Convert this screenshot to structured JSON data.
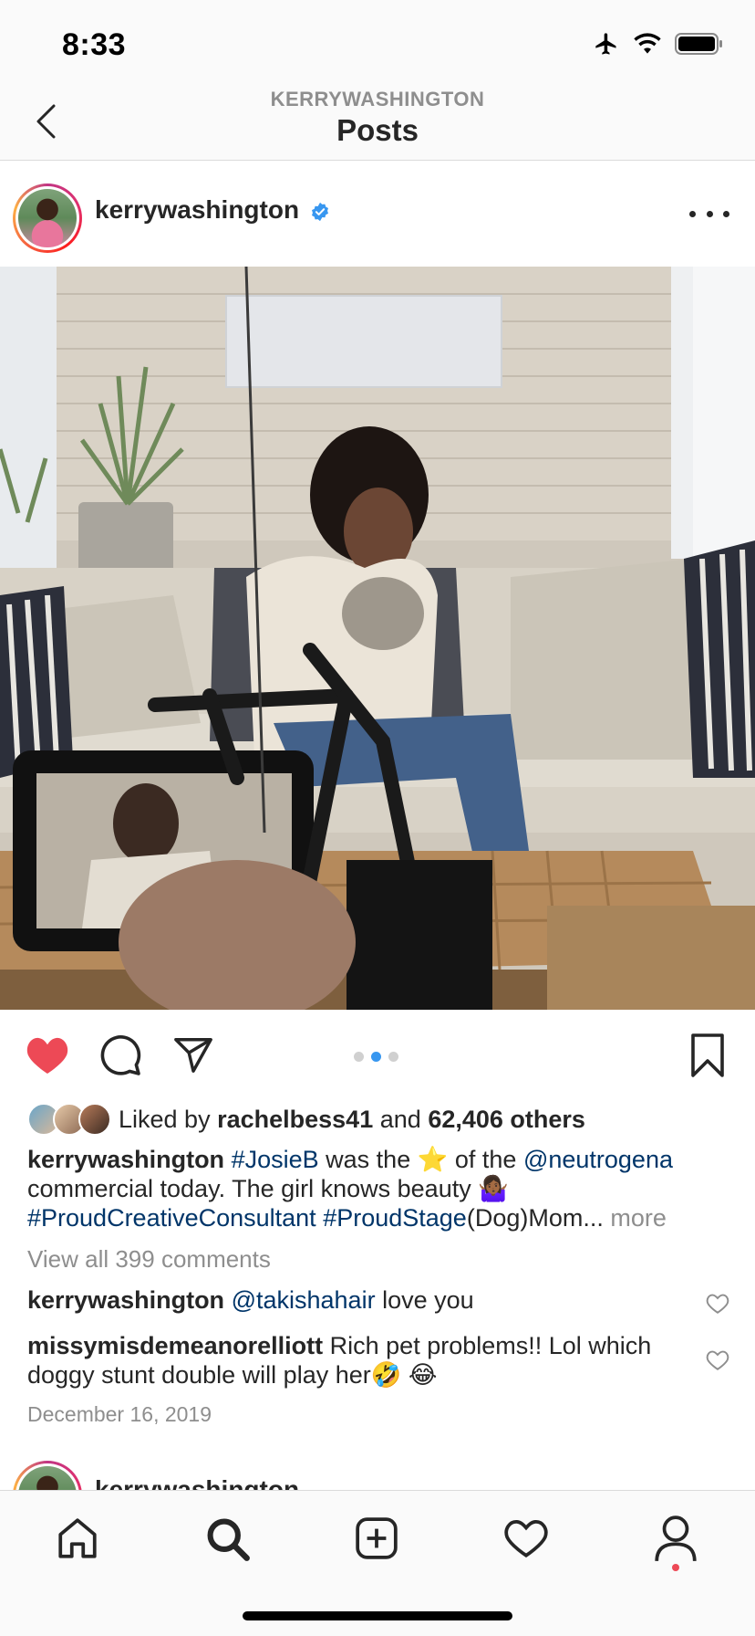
{
  "status_bar": {
    "time": "8:33"
  },
  "header": {
    "subtitle": "KERRYWASHINGTON",
    "title": "Posts"
  },
  "post": {
    "username": "kerrywashington",
    "likes": {
      "prefix": "Liked by",
      "user": "rachelbess41",
      "middle": "and",
      "count": "62,406 others"
    },
    "caption": {
      "username": "kerrywashington",
      "tag1": "#JosieB",
      "text1": "was the",
      "text2": "of the",
      "mention": "@neutrogena",
      "line2": "commercial today. The girl knows beauty",
      "tag2": "#ProudCreativeConsultant",
      "tag3": "#ProudStage",
      "text3": "(Dog)Mom...",
      "more": "more"
    },
    "view_all": "View all 399 comments",
    "comments": [
      {
        "username": "kerrywashington",
        "mention": "@takishahair",
        "text": "love you"
      },
      {
        "username": "missymisdemeanorelliott",
        "text": "Rich pet problems!! Lol which doggy stunt double will play her"
      }
    ],
    "date": "December 16, 2019",
    "carousel": {
      "count": 3,
      "active_index": 1
    }
  },
  "next_post": {
    "username": "kerrywashington"
  },
  "colors": {
    "like_red": "#ed4956",
    "link_blue": "#003569",
    "carousel_active": "#3897f0",
    "verified_blue": "#3897f0"
  }
}
